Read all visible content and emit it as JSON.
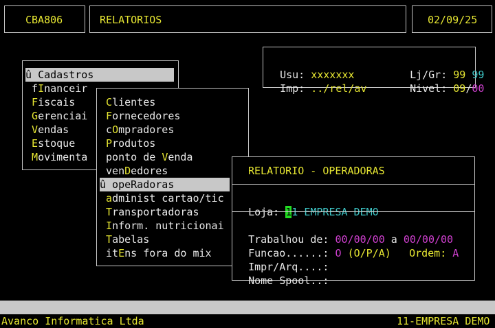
{
  "header": {
    "code": "CBA806",
    "title": "RELATORIOS",
    "date": "02/09/25"
  },
  "info": {
    "usu_label": "Usu:",
    "usu_value": "xxxxxxx",
    "ljgr_label": "Lj/Gr:",
    "lj_value": "99",
    "gr_value": "99",
    "imp_label": "Imp:",
    "imp_value": "../rel/av",
    "nivel_label": "Nivel:",
    "nivel_a": "09",
    "nivel_sep": "/",
    "nivel_b": "00"
  },
  "main_menu": {
    "items": [
      {
        "pre": "û ",
        "hot": "",
        "rest": "Cadastros",
        "selected": true
      },
      {
        "pre": " f",
        "hot": "I",
        "rest": "nanceir",
        "selected": false
      },
      {
        "pre": " ",
        "hot": "F",
        "rest": "iscais",
        "selected": false
      },
      {
        "pre": " ",
        "hot": "G",
        "rest": "erenciai",
        "selected": false
      },
      {
        "pre": " ",
        "hot": "V",
        "rest": "endas",
        "selected": false
      },
      {
        "pre": " ",
        "hot": "E",
        "rest": "stoque",
        "selected": false
      },
      {
        "pre": " ",
        "hot": "M",
        "rest": "ovimenta",
        "selected": false
      }
    ]
  },
  "sub_menu": {
    "items": [
      {
        "pre": " ",
        "hot": "C",
        "rest": "lientes",
        "selected": false
      },
      {
        "pre": " ",
        "hot": "F",
        "rest": "ornecedores",
        "selected": false
      },
      {
        "pre": " c",
        "hot": "O",
        "rest": "mpradores",
        "selected": false
      },
      {
        "pre": " ",
        "hot": "P",
        "rest": "rodutos",
        "selected": false
      },
      {
        "pre": " ponto de ",
        "hot": "V",
        "rest": "enda",
        "selected": false
      },
      {
        "pre": " ven",
        "hot": "D",
        "rest": "edores",
        "selected": false
      },
      {
        "pre": "û opeRadoras",
        "hot": "",
        "rest": "",
        "selected": true
      },
      {
        "pre": " ",
        "hot": "a",
        "rest": "dminist cartao/tic",
        "selected": false
      },
      {
        "pre": " ",
        "hot": "T",
        "rest": "ransportadoras",
        "selected": false
      },
      {
        "pre": " ",
        "hot": "I",
        "rest": "nform. nutricionai",
        "selected": false
      },
      {
        "pre": " ",
        "hot": "T",
        "rest": "abelas",
        "selected": false
      },
      {
        "pre": " it",
        "hot": "E",
        "rest": "ns fora do mix",
        "selected": false
      }
    ]
  },
  "dialog": {
    "title": "RELATORIO - OPERADORAS",
    "loja_label": "Loja:",
    "loja_cursor": "1",
    "loja_rest": "1",
    "loja_name": "EMPRESA DEMO",
    "trabalhou_label": "Trabalhou de:",
    "date_from": "00/00/00",
    "a_label": "a",
    "date_to": "00/00/00",
    "funcao_label": "Funcao......:",
    "funcao_value": "O",
    "funcao_opts": "(O/P/A)",
    "ordem_label": "Ordem:",
    "ordem_value": "A",
    "impr_label": "Impr/Arq....:",
    "spool_label": "Nome Spool..:"
  },
  "footer": {
    "company": "Avanco Informatica Ltda",
    "empresa": "11-EMPRESA DEMO"
  }
}
